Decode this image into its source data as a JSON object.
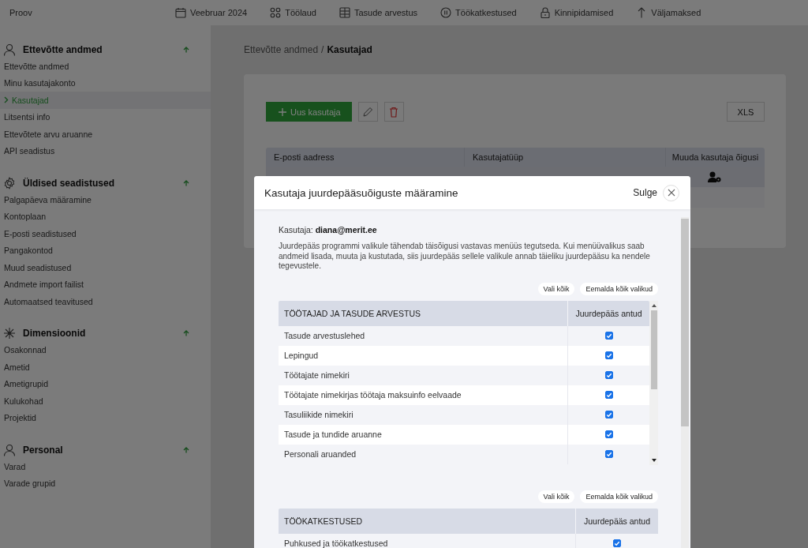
{
  "topbar": {
    "company": "Proov",
    "nav": [
      {
        "label": "Veebruar 2024"
      },
      {
        "label": "Töölaud"
      },
      {
        "label": "Tasude arvestus"
      },
      {
        "label": "Töökatkestused"
      },
      {
        "label": "Kinnipidamised"
      },
      {
        "label": "Väljamaksed"
      }
    ]
  },
  "sidebar": {
    "sections": [
      {
        "title": "Ettevõtte andmed",
        "expanded": true,
        "items": [
          {
            "label": "Ettevõtte andmed",
            "selected": false
          },
          {
            "label": "Minu kasutajakonto",
            "selected": false
          },
          {
            "label": "Kasutajad",
            "selected": true
          },
          {
            "label": "Litsentsi info",
            "selected": false
          },
          {
            "label": "Ettevõtete arvu aruanne",
            "selected": false
          },
          {
            "label": "API seadistus",
            "selected": false
          }
        ]
      },
      {
        "title": "Üldised seadistused",
        "expanded": true,
        "items": [
          {
            "label": "Palgapäeva määramine",
            "selected": false
          },
          {
            "label": "Kontoplaan",
            "selected": false
          },
          {
            "label": "E-posti seadistused",
            "selected": false
          },
          {
            "label": "Pangakontod",
            "selected": false
          },
          {
            "label": "Muud seadistused",
            "selected": false
          },
          {
            "label": "Andmete import failist",
            "selected": false
          },
          {
            "label": "Automaatsed teavitused",
            "selected": false
          }
        ]
      },
      {
        "title": "Dimensioonid",
        "expanded": true,
        "items": [
          {
            "label": "Osakonnad",
            "selected": false
          },
          {
            "label": "Ametid",
            "selected": false
          },
          {
            "label": "Ametigrupid",
            "selected": false
          },
          {
            "label": "Kulukohad",
            "selected": false
          },
          {
            "label": "Projektid",
            "selected": false
          }
        ]
      },
      {
        "title": "Personal",
        "expanded": true,
        "items": [
          {
            "label": "Varad",
            "selected": false
          },
          {
            "label": "Varade grupid",
            "selected": false
          }
        ]
      }
    ]
  },
  "main": {
    "breadcrumb": {
      "parent": "Ettevõtte andmed",
      "separator": "/",
      "current": "Kasutajad"
    },
    "toolbar": {
      "new_button": "Uus kasutaja",
      "export_button": "XLS"
    },
    "table": {
      "columns": [
        "E-posti aadress",
        "Kasutajatüüp",
        "Muuda kasutaja õigusi"
      ],
      "rows": [
        {
          "kind": "user"
        },
        {
          "kind": "blank"
        }
      ]
    }
  },
  "modal": {
    "title": "Kasutaja juurdepääsuõiguste määramine",
    "close_label": "Sulge",
    "user_line": "Kasutaja: **diana@merit.ee**",
    "description": "Juurdepääs programmi valikule tähendab täisõigusi vastavas menüüs tegutseda. Kui menüüvalikus saab andmeid lisada, muuta ja kustutada, siis juurdepääs sellele valikule annab täieliku juurdepääsu ka nendele tegevustele.",
    "groups": [
      {
        "select_all": "Vali kõik",
        "clear_all": "Eemalda kõik valikud",
        "title": "TÖÖTAJAD JA TASUDE ARVESTUS",
        "access_column": "Juurdepääs antud",
        "scrollable": true,
        "rows": [
          {
            "label": "Tasude arvestuslehed",
            "checked": true
          },
          {
            "label": "Lepingud",
            "checked": true
          },
          {
            "label": "Töötajate nimekiri",
            "checked": true
          },
          {
            "label": "Töötajate nimekirjas töötaja maksuinfo eelvaade",
            "checked": true
          },
          {
            "label": "Tasuliikide nimekiri",
            "checked": true
          },
          {
            "label": "Tasude ja tundide aruanne",
            "checked": true
          },
          {
            "label": "Personali aruanded",
            "checked": true
          }
        ]
      },
      {
        "select_all": "Vali kõik",
        "clear_all": "Eemalda kõik valikud",
        "title": "TÖÖKATKESTUSED",
        "access_column": "Juurdepääs antud",
        "scrollable": false,
        "rows": [
          {
            "label": "Puhkused ja töökatkestused",
            "checked": true
          }
        ]
      }
    ]
  }
}
